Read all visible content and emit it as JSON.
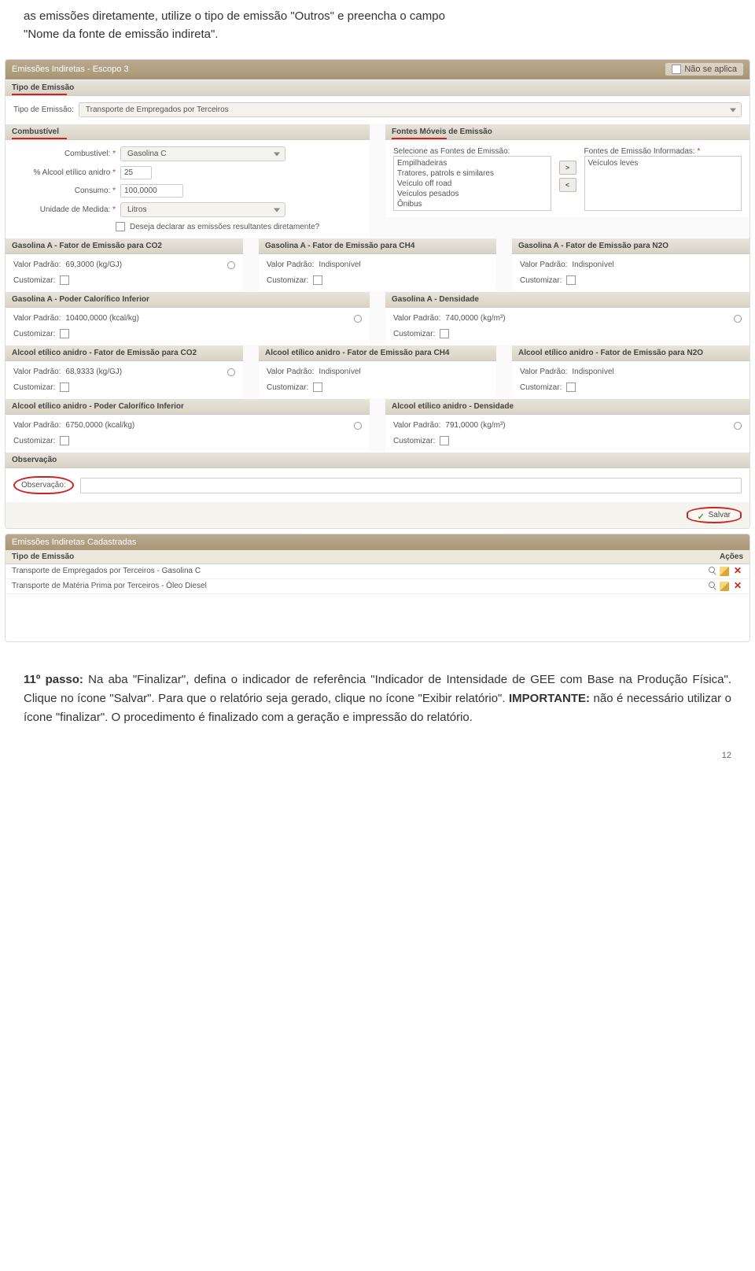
{
  "intro": {
    "line1": "as emissões diretamente, utilize o tipo de emissão \"Outros\" e preencha o campo",
    "line2": "\"Nome da fonte de emissão indireta\"."
  },
  "header": {
    "title": "Emissões Indiretas - Escopo 3",
    "nao_aplica": "Não se aplica"
  },
  "tipo_emissao": {
    "section": "Tipo de Emissão",
    "label": "Tipo de Emissão:",
    "value": "Transporte de Empregados por Terceiros"
  },
  "combustivel": {
    "section": "Combustível",
    "combustivel_label": "Combustível:",
    "combustivel_value": "Gasolina C",
    "perc_label": "% Alcool etílico anidro",
    "perc_value": "25",
    "consumo_label": "Consumo:",
    "consumo_value": "100,0000",
    "unidade_label": "Unidade de Medida:",
    "unidade_value": "Litros",
    "declarar": "Deseja declarar as emissões resultantes diretamente?"
  },
  "fontes": {
    "section": "Fontes Móveis de Emissão",
    "select_label": "Selecione as Fontes de Emissão:",
    "options": [
      "Empilhadeiras",
      "Tratores, patrols e similares",
      "Veículo off road",
      "Veículos pesados",
      "Ônibus"
    ],
    "inform_label": "Fontes de Emissão Informadas:",
    "informed": "Veículos leves"
  },
  "factors": {
    "gasolinaA_co2": {
      "title": "Gasolina A - Fator de Emissão para CO2",
      "padrao_label": "Valor Padrão:",
      "padrao": "69,3000 (kg/GJ)",
      "custom": "Customizar:"
    },
    "gasolinaA_ch4": {
      "title": "Gasolina A - Fator de Emissão para CH4",
      "padrao_label": "Valor Padrão:",
      "padrao": "Indisponível",
      "custom": "Customizar:"
    },
    "gasolinaA_n2o": {
      "title": "Gasolina A - Fator de Emissão para N2O",
      "padrao_label": "Valor Padrão:",
      "padrao": "Indisponível",
      "custom": "Customizar:"
    },
    "gasolinaA_pci": {
      "title": "Gasolina A - Poder Calorífico Inferior",
      "padrao_label": "Valor Padrão:",
      "padrao": "10400,0000 (kcal/kg)",
      "custom": "Customizar:"
    },
    "gasolinaA_den": {
      "title": "Gasolina A - Densidade",
      "padrao_label": "Valor Padrão:",
      "padrao": "740,0000 (kg/m³)",
      "custom": "Customizar:"
    },
    "alcool_co2": {
      "title": "Alcool etílico anidro - Fator de Emissão para CO2",
      "padrao_label": "Valor Padrão:",
      "padrao": "68,9333 (kg/GJ)",
      "custom": "Customizar:"
    },
    "alcool_ch4": {
      "title": "Alcool etílico anidro - Fator de Emissão para CH4",
      "padrao_label": "Valor Padrão:",
      "padrao": "Indisponível",
      "custom": "Customizar:"
    },
    "alcool_n2o": {
      "title": "Alcool etílico anidro - Fator de Emissão para N2O",
      "padrao_label": "Valor Padrão:",
      "padrao": "Indisponível",
      "custom": "Customizar:"
    },
    "alcool_pci": {
      "title": "Alcool etílico anidro - Poder Calorífico Inferior",
      "padrao_label": "Valor Padrão:",
      "padrao": "6750,0000 (kcal/kg)",
      "custom": "Customizar:"
    },
    "alcool_den": {
      "title": "Alcool etílico anidro - Densidade",
      "padrao_label": "Valor Padrão:",
      "padrao": "791,0000 (kg/m³)",
      "custom": "Customizar:"
    }
  },
  "obs": {
    "section": "Observação",
    "label": "Observação:"
  },
  "save": "Salvar",
  "cadastradas": {
    "header": "Emissões Indiretas Cadastradas",
    "col_tipo": "Tipo de Emissão",
    "col_acoes": "Ações",
    "rows": [
      "Transporte de Empregados por Terceiros - Gasolina C",
      "Transporte de Matéria Prima por Terceiros - Óleo Diesel"
    ]
  },
  "outro": {
    "p1a": "11º passo:",
    "p1b": " Na aba \"Finalizar\", defina o indicador de referência \"Indicador de Intensidade de GEE com Base na Produção Física\". Clique no ícone \"Salvar\". Para que o relatório seja gerado, clique no ícone \"Exibir relatório\". ",
    "p1c": "IMPORTANTE:",
    "p1d": " não é necessário utilizar o ícone \"finalizar\". O procedimento é finalizado com a geração e impressão do relatório."
  },
  "page": "12"
}
